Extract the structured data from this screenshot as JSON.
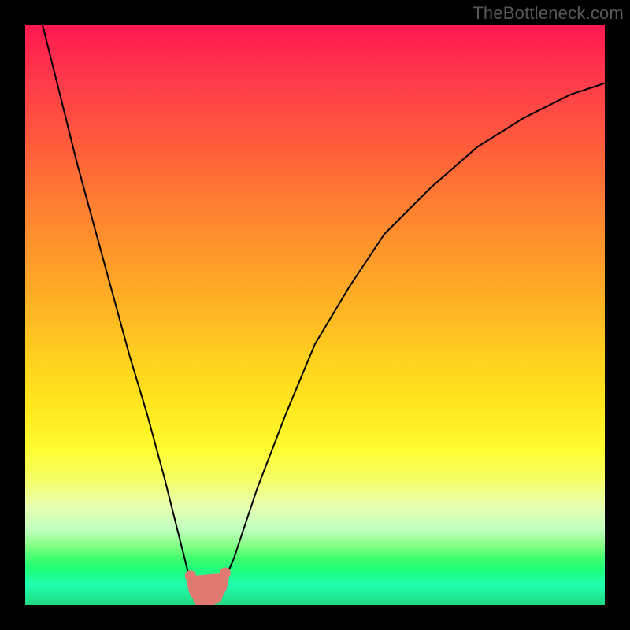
{
  "watermark": "TheBottleneck.com",
  "colors": {
    "frame": "#000000",
    "curve": "#000000",
    "marker": "#e07a70"
  },
  "chart_data": {
    "type": "line",
    "title": "",
    "xlabel": "",
    "ylabel": "",
    "xlim": [
      0,
      100
    ],
    "ylim": [
      0,
      100
    ],
    "series": [
      {
        "name": "curve",
        "x": [
          3,
          6,
          9,
          12,
          15,
          18,
          21,
          24,
          27,
          28.5,
          30,
          31.5,
          33,
          36,
          40,
          45,
          50,
          56,
          62,
          70,
          78,
          86,
          94,
          100
        ],
        "y": [
          100,
          88,
          76,
          65,
          54,
          43,
          33,
          22,
          10,
          4,
          1,
          0,
          1,
          8,
          20,
          33,
          45,
          55,
          64,
          72,
          79,
          84,
          88,
          90
        ]
      }
    ],
    "marker": {
      "name": "bottom-cluster",
      "points_xy": [
        [
          28.5,
          5
        ],
        [
          29,
          2.5
        ],
        [
          30,
          0.7
        ],
        [
          31.5,
          0.3
        ],
        [
          33,
          1.2
        ],
        [
          34,
          3
        ],
        [
          34.5,
          5.5
        ]
      ]
    },
    "gradient_stops": [
      {
        "pct": 0,
        "hex": "#ff1850"
      },
      {
        "pct": 10,
        "hex": "#ff3c4a"
      },
      {
        "pct": 20,
        "hex": "#ff5a3c"
      },
      {
        "pct": 32,
        "hex": "#ff8230"
      },
      {
        "pct": 45,
        "hex": "#ffa826"
      },
      {
        "pct": 58,
        "hex": "#ffd21e"
      },
      {
        "pct": 66,
        "hex": "#ffe81e"
      },
      {
        "pct": 73,
        "hex": "#fffc30"
      },
      {
        "pct": 78,
        "hex": "#f6ff60"
      },
      {
        "pct": 83,
        "hex": "#e6ffb0"
      },
      {
        "pct": 87,
        "hex": "#c0ffc0"
      },
      {
        "pct": 90,
        "hex": "#80ff80"
      },
      {
        "pct": 92,
        "hex": "#40ff70"
      },
      {
        "pct": 94,
        "hex": "#1eff7c"
      },
      {
        "pct": 96.5,
        "hex": "#20ffb0"
      },
      {
        "pct": 100,
        "hex": "#20d880"
      }
    ]
  }
}
